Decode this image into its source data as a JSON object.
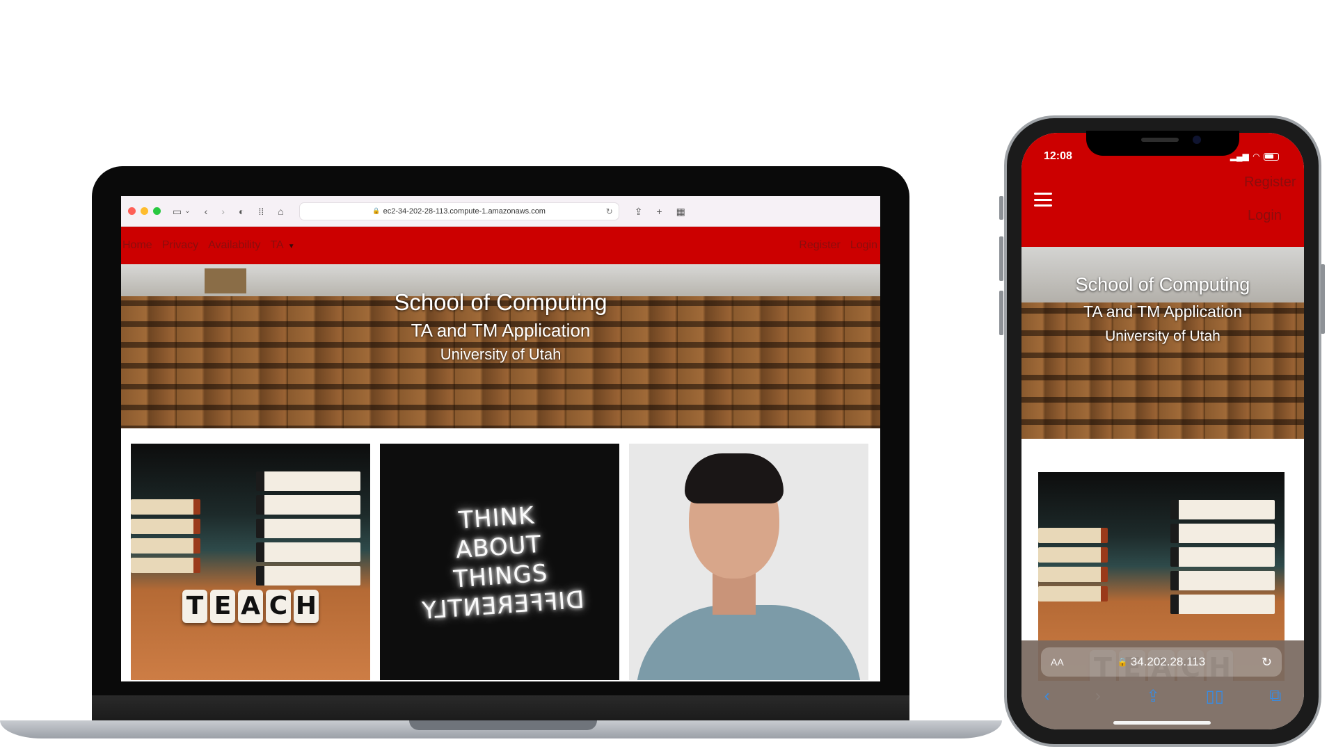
{
  "laptop": {
    "browser": {
      "url": "ec2-34-202-28-113.compute-1.amazonaws.com",
      "icons": [
        "sidebar-icon",
        "chevron-down-icon",
        "back-icon",
        "forward-icon",
        "shield-icon",
        "grid-icon",
        "home-icon",
        "lock-icon",
        "reload-icon",
        "share-icon",
        "new-tab-icon",
        "tab-overview-icon"
      ]
    },
    "nav": {
      "left": [
        "Home",
        "Privacy",
        "Availability",
        "TA"
      ],
      "right": [
        "Register",
        "Login"
      ]
    },
    "hero": {
      "title": "School of Computing",
      "subtitle": "TA and TM Application",
      "org": "University of Utah"
    },
    "cards": {
      "teach_letters": [
        "T",
        "E",
        "A",
        "C",
        "H"
      ],
      "neon_lines": [
        "THINK",
        "ABOUT",
        "THINGS",
        "DIFFERENTLY"
      ]
    }
  },
  "phone": {
    "status": {
      "time": "12:08"
    },
    "nav": {
      "register": "Register",
      "login": "Login"
    },
    "hero": {
      "title": "School of Computing",
      "subtitle": "TA and TM Application",
      "org": "University of Utah"
    },
    "card": {
      "teach_letters": [
        "T",
        "E",
        "A",
        "C",
        "H"
      ]
    },
    "safari": {
      "text_size_label": "AA",
      "url": "34.202.28.113"
    }
  },
  "colors": {
    "brand_red": "#cc0000",
    "nav_link": "#8b0d0d",
    "safari_tint": "#3a8be0"
  }
}
